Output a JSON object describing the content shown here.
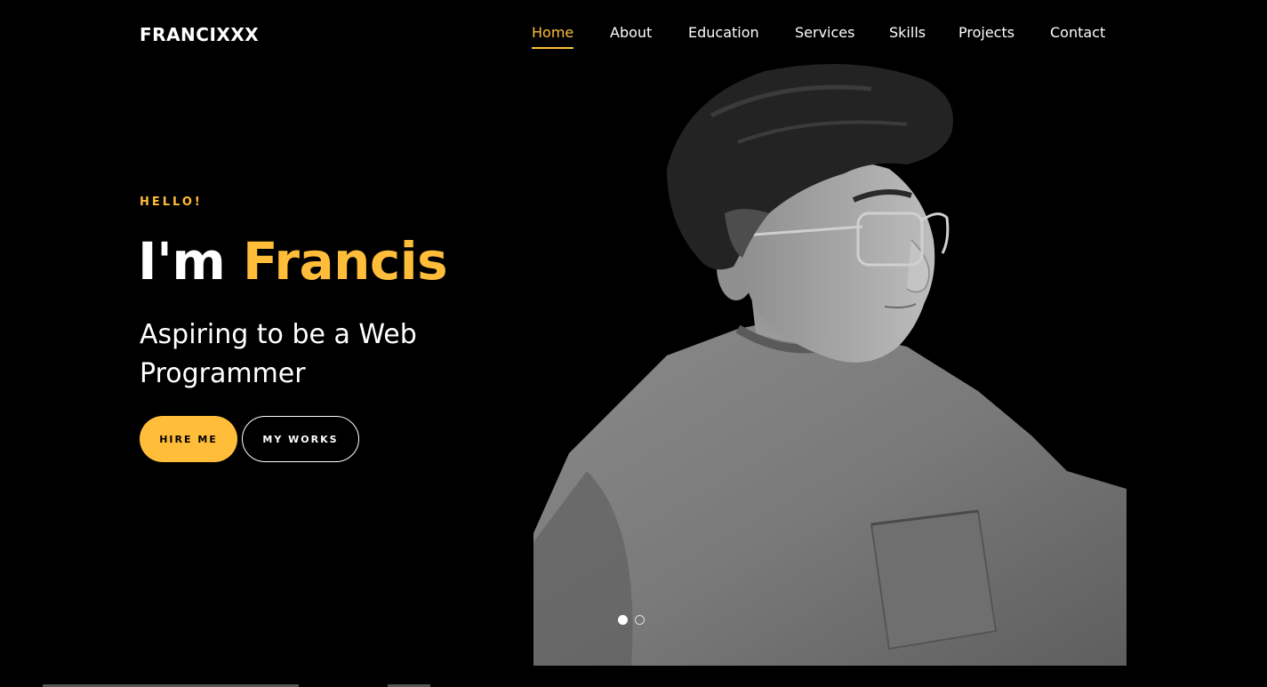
{
  "brand": {
    "name": "FRANCIXXX"
  },
  "nav": {
    "items": [
      {
        "label": "Home",
        "active": true
      },
      {
        "label": "About"
      },
      {
        "label": "Education"
      },
      {
        "label": "Services"
      },
      {
        "label": "Skills"
      },
      {
        "label": "Projects"
      },
      {
        "label": "Contact"
      }
    ]
  },
  "hero": {
    "greeting": "HELLO!",
    "title_prefix": "I'm ",
    "title_name": "Francis",
    "tagline": "Aspiring to be a Web Programmer",
    "hire_button": "HIRE ME",
    "works_button": "MY WORKS"
  },
  "slider": {
    "total": 2,
    "active": 1
  },
  "colors": {
    "accent": "#ffbd39",
    "background": "#000000",
    "text": "#ffffff"
  }
}
